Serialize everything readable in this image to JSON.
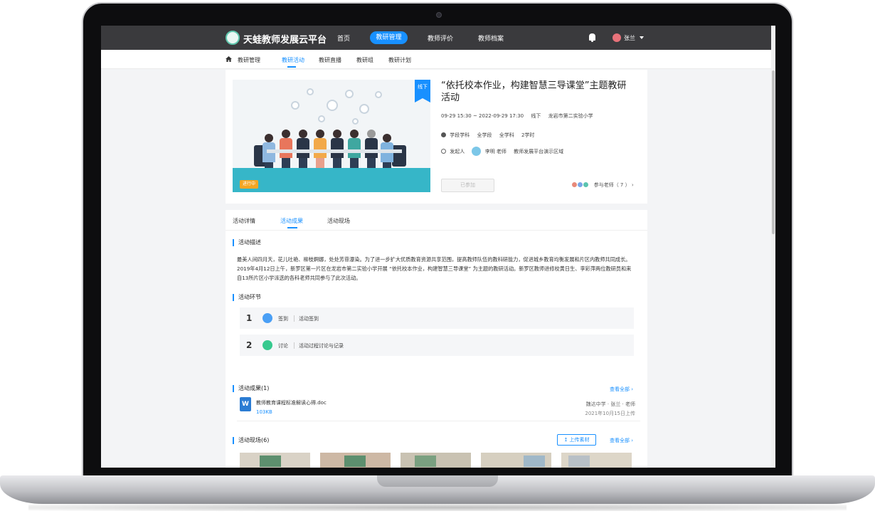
{
  "app": {
    "name": "天蛙教师发展云平台",
    "nav": [
      "首页",
      "教研管理",
      "教师评价",
      "教师档案"
    ],
    "active_nav": "教研管理",
    "user_name": "张兰"
  },
  "subnav": {
    "items": [
      "教研管理",
      "教研活动",
      "教研直播",
      "教研组",
      "教研计划"
    ],
    "active": "教研活动"
  },
  "activity": {
    "mode_tag": "线下",
    "status_tag": "进行中",
    "title": "“依托校本作业，构建智慧三导课堂”主题教研活动",
    "time": "09-29 15:30 ~ 2022-09-29 17:30",
    "mode": "线下",
    "location": "龙岩市第二实验小学",
    "subject_label": "学段学科",
    "stage": "全学段",
    "subject": "全学科",
    "hours": "2学时",
    "initiator_label": "发起人",
    "initiator": "李明 老师",
    "org": "教师发展平台演示区域",
    "join_button": "已参加",
    "participants": "参与老师（ 7 ）"
  },
  "tabs": [
    "活动详情",
    "活动成果",
    "活动现场"
  ],
  "active_tab": "活动成果",
  "description": {
    "title": "活动描述",
    "text": "最美人间四月天，花儿吐艳、柳枝婀娜，处处芳菲瀑染。为了进一步扩大优质教育资源共享范围，提高教师队伍的教科研能力，促进城乡教育均衡发展和片区内教师共同成长。2019年4月12日上午，新罗区第一片区在龙岩市第二实验小学开展 “依托校本作业，构建智慧三导课堂” 为主题的教研活动。新罗区教师进修校黄日生、李彩萍两位教研员和来自13所片区小学派选的各科老师共同参与了此次活动。"
  },
  "steps": {
    "title": "活动环节",
    "items": [
      {
        "num": "1",
        "label": "签到",
        "desc": "活动签到",
        "color": "#4a9ff5"
      },
      {
        "num": "2",
        "label": "讨论",
        "desc": "活动过程讨论与记录",
        "color": "#36c98e"
      }
    ]
  },
  "results": {
    "title": "活动成果(1)",
    "view_all": "查看全部",
    "file_type": "W",
    "file_name": "教师教育课程标准解读心得.doc",
    "file_size": "103KB",
    "owner": "魏达中学 · 张兰 · 老师",
    "date": "2021年10月15日上传"
  },
  "scene": {
    "title": "活动现场(6)",
    "upload": "上传素材",
    "view_all": "查看全部",
    "photo_count": 5
  }
}
